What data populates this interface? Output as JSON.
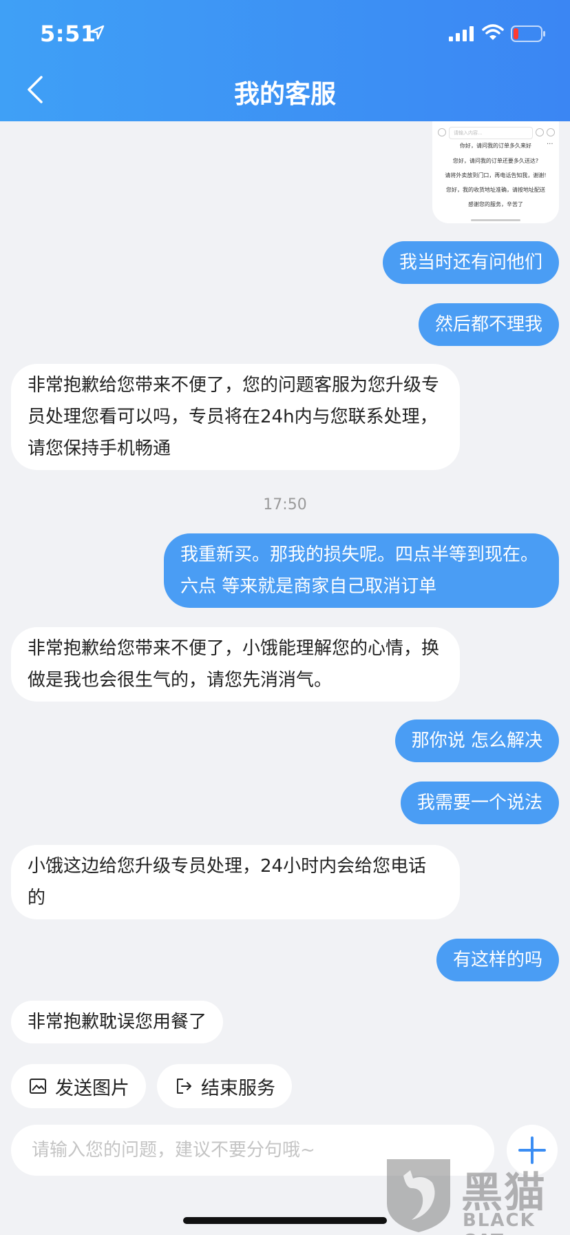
{
  "status_bar": {
    "time": "5:51"
  },
  "header": {
    "title": "我的客服"
  },
  "thumbnail": {
    "input_placeholder": "请输入内容...",
    "lines": [
      "你好，请问我的订单多久来好",
      "您好，请问我的订单还要多久送达?",
      "请将外卖放到门口，再电话告知我，谢谢!",
      "您好，我的收货地址准确，请按地址配送",
      "感谢您的服务，辛苦了"
    ],
    "more": "···"
  },
  "messages": [
    {
      "text": "我当时还有问他们"
    },
    {
      "text": "然后都不理我"
    },
    {
      "text": "非常抱歉给您带来不便了，您的问题客服为您升级专员处理您看可以吗，专员将在24h内与您联系处理，请您保持手机畅通"
    },
    {
      "text": "我重新买。那我的损失呢。四点半等到现在。六点 等来就是商家自己取消订单"
    },
    {
      "text": "非常抱歉给您带来不便了，小饿能理解您的心情，换做是我也会很生气的，请您先消消气。"
    },
    {
      "text": "那你说 怎么解决"
    },
    {
      "text": "我需要一个说法"
    },
    {
      "text": "小饿这边给您升级专员处理，24小时内会给您电话的"
    },
    {
      "text": "有这样的吗"
    },
    {
      "text": "非常抱歉耽误您用餐了"
    }
  ],
  "time_label": "17:50",
  "actions": {
    "send_image": "发送图片",
    "end_service": "结束服务"
  },
  "input": {
    "placeholder": "请输入您的问题，建议不要分句哦~"
  },
  "watermark": {
    "text": "黑猫",
    "sub": "BLACK CAT"
  },
  "colors": {
    "header_start": "#3fa0f6",
    "header_end": "#3b86f3",
    "outgoing_bubble": "#4a9df4",
    "incoming_bubble": "#ffffff",
    "background": "#f1f2f5"
  }
}
